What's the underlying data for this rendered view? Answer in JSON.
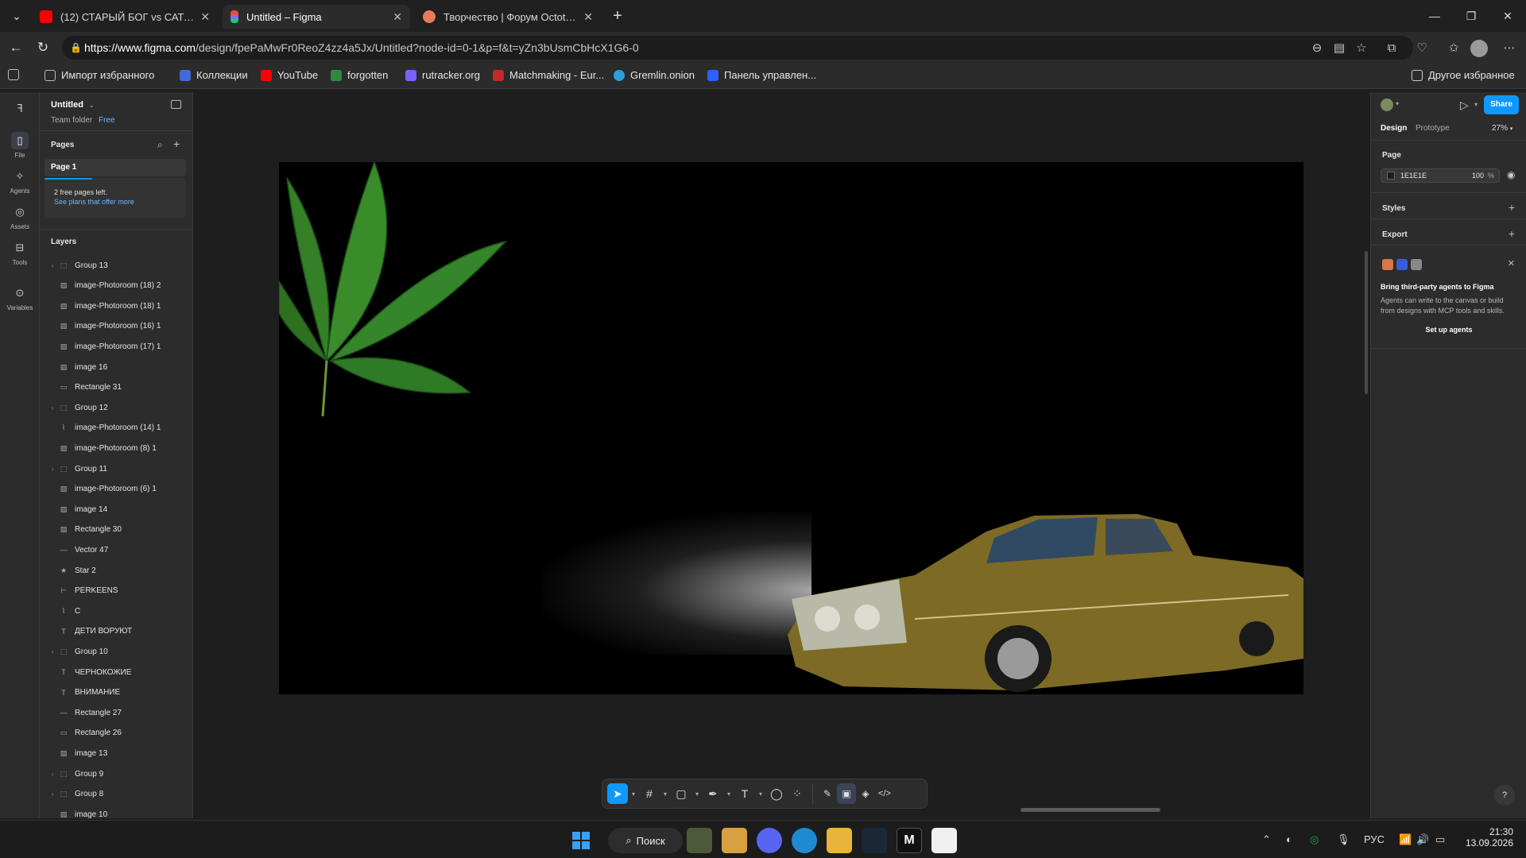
{
  "browser": {
    "tabs": [
      {
        "title": "(12) СТАРЫЙ БОГ vs САТАНИКА",
        "color": "#ff0000"
      },
      {
        "title": "Untitled – Figma",
        "color": "#a259ff"
      },
      {
        "title": "Творчество | Форум Octothorp",
        "color": "#e87a5a"
      }
    ],
    "new_tab": "+",
    "url_host": "https://www.figma.com",
    "url_path": "/design/fpePaMwFr0ReoZ4zz4a5Jx/Untitled?node-id=0-1&p=f&t=yZn3bUsmCbHcX1G6-0",
    "bookmarks": [
      {
        "label": "Импорт избранного",
        "color": "#9a9a9a"
      },
      {
        "label": "Коллекции",
        "color": "#3f6bd8"
      },
      {
        "label": "YouTube",
        "color": "#ff0000"
      },
      {
        "label": "forgotten",
        "color": "#2e8b3d"
      },
      {
        "label": "rutracker.org",
        "color": "#7b61ff"
      },
      {
        "label": "Matchmaking - Eur...",
        "color": "#c62828"
      },
      {
        "label": "Gremlin.onion",
        "color": "#2aa1da"
      },
      {
        "label": "Панель управлен...",
        "color": "#2962ff"
      }
    ],
    "other_bookmarks": "Другое избранное"
  },
  "figma": {
    "file_name": "Untitled",
    "team_folder": "Team folder",
    "plan": "Free",
    "rail": [
      {
        "label": "File",
        "icon": "file-icon"
      },
      {
        "label": "Agents",
        "icon": "agents-icon"
      },
      {
        "label": "Assets",
        "icon": "assets-icon"
      },
      {
        "label": "Tools",
        "icon": "tools-icon"
      },
      {
        "label": "Variables",
        "icon": "variables-icon"
      }
    ],
    "pages_title": "Pages",
    "page_1": "Page 1",
    "free_pages_note": "2 free pages left.",
    "see_plans": "See plans that offer more",
    "layers_title": "Layers",
    "layers": [
      {
        "name": "Group 13",
        "icon": "group",
        "chevron": true
      },
      {
        "name": "image-Photoroom (18) 2",
        "icon": "image"
      },
      {
        "name": "image-Photoroom (18) 1",
        "icon": "image"
      },
      {
        "name": "image-Photoroom (16) 1",
        "icon": "image"
      },
      {
        "name": "image-Photoroom (17) 1",
        "icon": "image"
      },
      {
        "name": "image 16",
        "icon": "image"
      },
      {
        "name": "Rectangle 31",
        "icon": "rect"
      },
      {
        "name": "Group 12",
        "icon": "group",
        "chevron": true
      },
      {
        "name": "image-Photoroom (14) 1",
        "icon": "vector"
      },
      {
        "name": "image-Photoroom (8) 1",
        "icon": "image"
      },
      {
        "name": "Group 11",
        "icon": "group",
        "chevron": true
      },
      {
        "name": "image-Photoroom (6) 1",
        "icon": "image"
      },
      {
        "name": "image 14",
        "icon": "image"
      },
      {
        "name": "Rectangle 30",
        "icon": "image"
      },
      {
        "name": "Vector 47",
        "icon": "line"
      },
      {
        "name": "Star 2",
        "icon": "star"
      },
      {
        "name": "PERKEENS",
        "icon": "hframe"
      },
      {
        "name": "C",
        "icon": "vector"
      },
      {
        "name": "ДЕТИ ВОРУЮТ",
        "icon": "text"
      },
      {
        "name": "Group 10",
        "icon": "group",
        "chevron": true
      },
      {
        "name": "ЧЕРНОКОЖИЕ",
        "icon": "text"
      },
      {
        "name": "ВНИМАНИЕ",
        "icon": "text"
      },
      {
        "name": "Rectangle 27",
        "icon": "line"
      },
      {
        "name": "Rectangle 26",
        "icon": "rect"
      },
      {
        "name": "image 13",
        "icon": "image"
      },
      {
        "name": "Group 9",
        "icon": "group",
        "chevron": true
      },
      {
        "name": "Group 8",
        "icon": "group",
        "chevron": true
      },
      {
        "name": "image 10",
        "icon": "image"
      }
    ],
    "right": {
      "share": "Share",
      "tab_design": "Design",
      "tab_prototype": "Prototype",
      "zoom": "27%",
      "page_section": "Page",
      "page_color": "1E1E1E",
      "page_opacity": "100",
      "percent": "%",
      "styles": "Styles",
      "export": "Export",
      "agents_title": "Bring third-party agents to Figma",
      "agents_desc": "Agents can write to the canvas or build from designs with MCP tools and skills.",
      "setup_agents": "Set up agents",
      "help": "?"
    },
    "accent": "#0d99ff"
  },
  "taskbar": {
    "search": "Поиск",
    "lang": "РУС",
    "time": "21:30",
    "date": "13.09.2026"
  }
}
